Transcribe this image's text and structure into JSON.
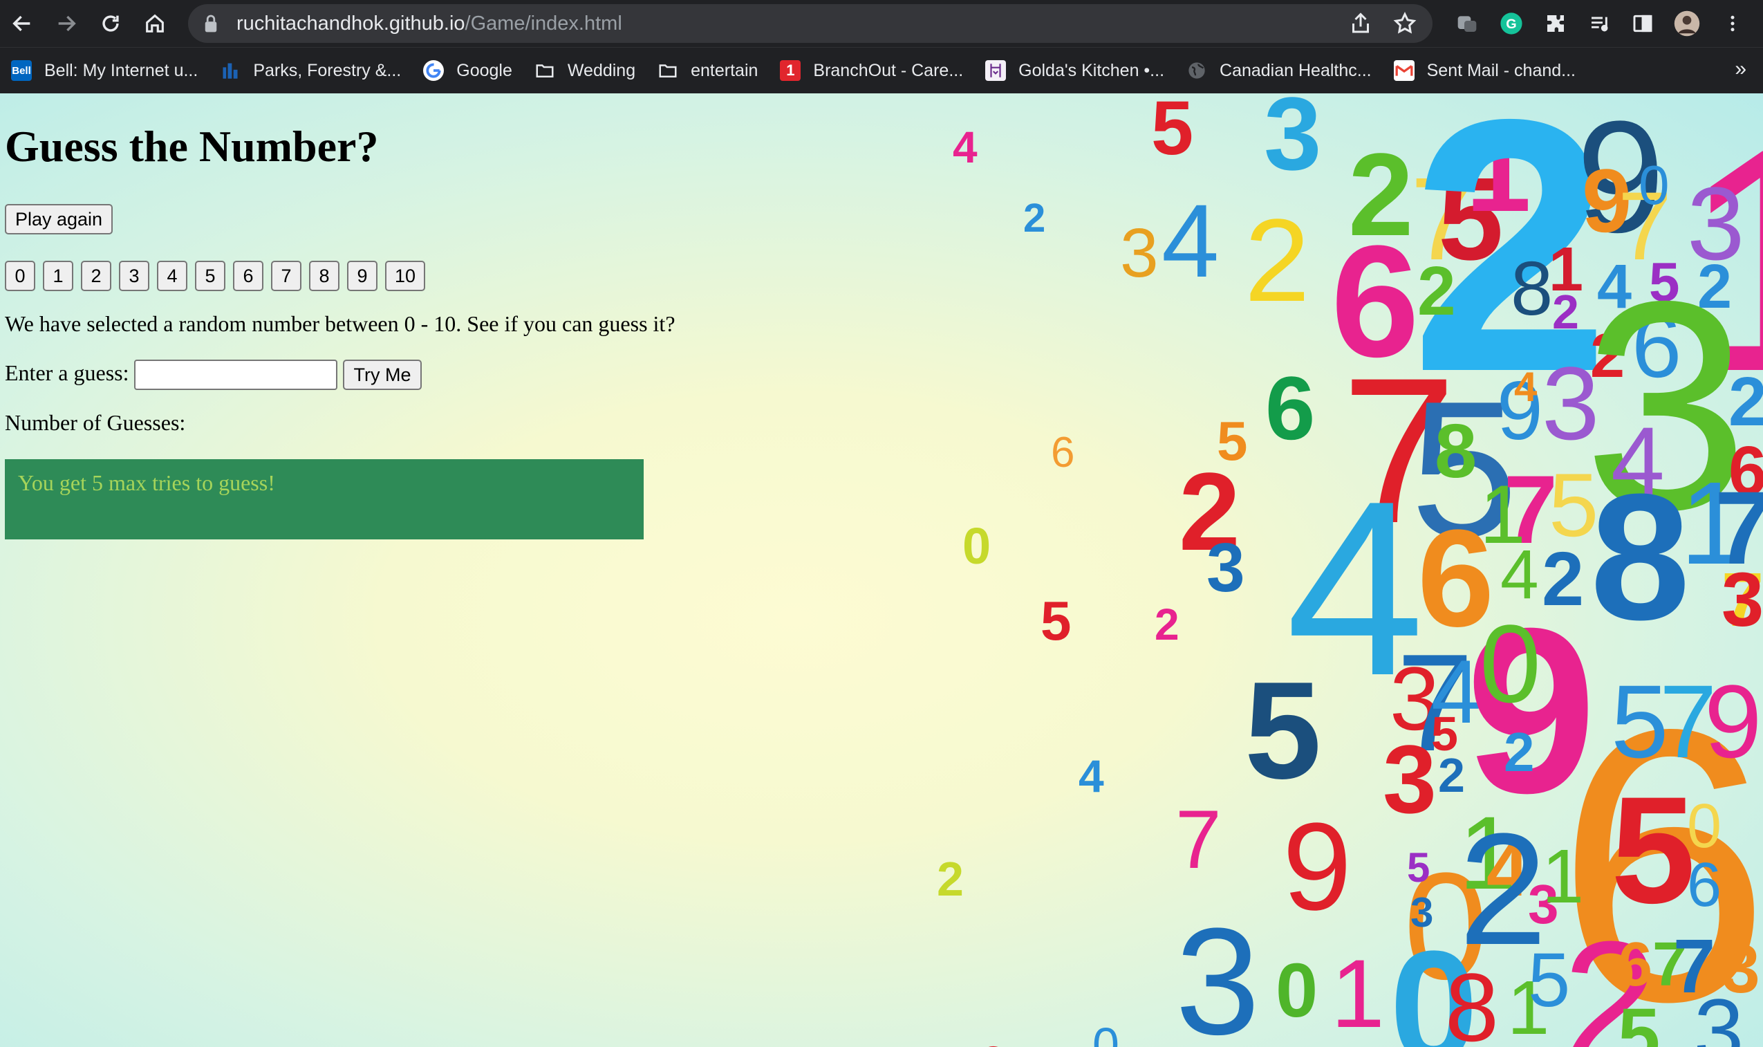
{
  "browser": {
    "url_host": "ruchitachandhok.github.io",
    "url_path": "/Game/index.html",
    "bookmarks": [
      {
        "label": "Bell: My Internet u...",
        "icon": "bell-icon"
      },
      {
        "label": "Parks, Forestry &...",
        "icon": "city-icon"
      },
      {
        "label": "Google",
        "icon": "google-icon"
      },
      {
        "label": "Wedding",
        "icon": "folder-icon"
      },
      {
        "label": "entertain",
        "icon": "folder-icon"
      },
      {
        "label": "BranchOut - Care...",
        "icon": "branchout-icon"
      },
      {
        "label": "Golda's Kitchen •...",
        "icon": "golda-icon"
      },
      {
        "label": "Canadian Healthc...",
        "icon": "globe-icon"
      },
      {
        "label": "Sent Mail - chand...",
        "icon": "gmail-icon"
      }
    ],
    "more_bookmarks": "»"
  },
  "game": {
    "title": "Guess the Number?",
    "play_again": "Play again",
    "number_buttons": [
      "0",
      "1",
      "2",
      "3",
      "4",
      "5",
      "6",
      "7",
      "8",
      "9",
      "10"
    ],
    "info": "We have selected a random number between 0 - 10. See if you can guess it?",
    "guess_label": "Enter a guess:",
    "guess_value": "",
    "try_me": "Try Me",
    "guesses_label": "Number of Guesses:",
    "message": "You get 5 max tries to guess!"
  },
  "colors": {
    "message_bg": "#2e8b57",
    "message_text": "#a6d45a"
  }
}
